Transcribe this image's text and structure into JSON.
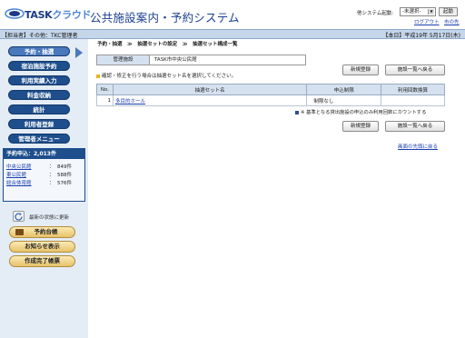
{
  "header": {
    "logo_text_a": "TASK",
    "logo_text_b": "クラウド",
    "app_title": "公共施設案内・予約システム",
    "system_launch_label": "他システム起動:",
    "system_select_value": "-未選択-",
    "launch_button": "起動",
    "logout_link": "ログアウト",
    "top_link": "市の先"
  },
  "infobar": {
    "user": "【担当者】その他：TKC管理者",
    "date": "【本日】平成19年 5月17日(木)"
  },
  "sidebar": {
    "nav": [
      {
        "label": "予約・抽選"
      },
      {
        "label": "宿泊施設予約"
      },
      {
        "label": "利用実績入力"
      },
      {
        "label": "料金収納"
      },
      {
        "label": "統計"
      },
      {
        "label": "利用者登録"
      },
      {
        "label": "管理者メニュー"
      }
    ],
    "requests": {
      "title": "予約申込：2,013件",
      "rows": [
        {
          "name": "中央公民館",
          "colon": "：",
          "count": "849件"
        },
        {
          "name": "東公民館",
          "colon": "：",
          "count": "588件"
        },
        {
          "name": "総合体育館",
          "colon": "：",
          "count": "576件"
        }
      ]
    },
    "refresh_label": "最新の状態に更新",
    "tan_buttons": [
      {
        "label": "予約台帳"
      },
      {
        "label": "お知らせ表示"
      },
      {
        "label": "作成完了帳票"
      }
    ]
  },
  "main": {
    "breadcrumb": "予約・抽選　≫　抽選セットの設定　≫　抽選セット構成一覧",
    "facility_label": "管理施設",
    "facility_value": "TASK市中央公民館",
    "new_register_button": "新規登録",
    "back_to_list_button": "施設一覧へ戻る",
    "hint": "確認・修正を行う場合は抽選セット名を選択してください。",
    "table": {
      "headers": [
        "No.",
        "抽選セット名",
        "申込制限",
        "利用回数換算"
      ],
      "rows": [
        {
          "no": "1",
          "name": "多目的ホール",
          "limit": "制限なし",
          "conv": ""
        }
      ]
    },
    "note": "※ 基準となる貸出施設の申込のみ利用回数にカウントする",
    "back_to_top": "画面の先頭に戻る"
  }
}
